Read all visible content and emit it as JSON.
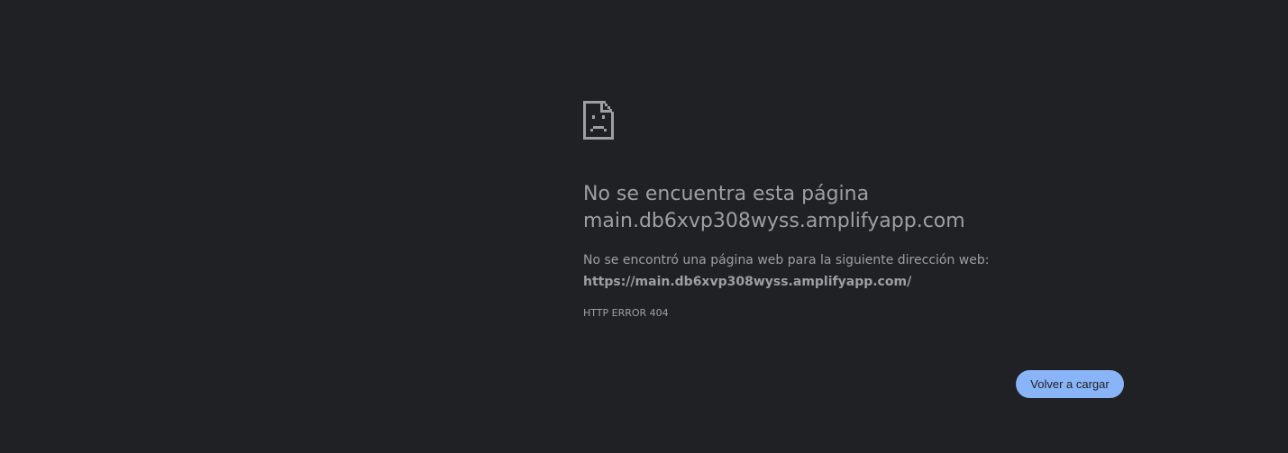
{
  "error": {
    "icon": "sad-document-icon",
    "title_line1": "No se encuentra esta página",
    "title_line2": "main.db6xvp308wyss.amplifyapp.com",
    "description": "No se encontró una página web para la siguiente dirección web:",
    "url": "https://main.db6xvp308wyss.amplifyapp.com/",
    "code": "HTTP ERROR 404"
  },
  "actions": {
    "reload_label": "Volver a cargar"
  },
  "colors": {
    "background": "#202124",
    "text": "#9aa0a6",
    "button": "#8ab4f8"
  }
}
